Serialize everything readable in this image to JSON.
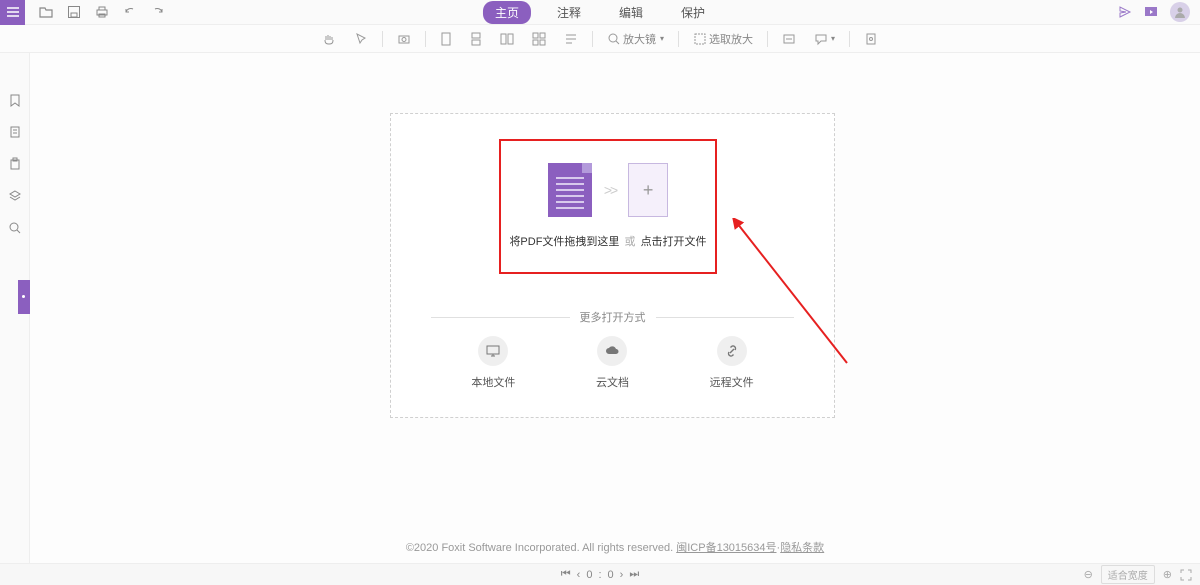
{
  "tabs": {
    "home": "主页",
    "annotate": "注释",
    "edit": "编辑",
    "protect": "保护"
  },
  "toolbar": {
    "zoom": "放大镜",
    "select_zoom": "选取放大"
  },
  "drop": {
    "drag_text": "将PDF文件拖拽到这里",
    "or": "或",
    "click_text": "点击打开文件"
  },
  "more_label": "更多打开方式",
  "open_options": {
    "local": "本地文件",
    "cloud": "云文档",
    "remote": "远程文件"
  },
  "copyright": {
    "text": "©2020 Foxit Software Incorporated. All rights reserved.",
    "icp": "闽ICP备13015634号",
    "sep": "·",
    "privacy": "隐私条款"
  },
  "status": {
    "page_cur": "0",
    "page_sep": ":",
    "page_total": "0",
    "fit": "适合宽度"
  }
}
